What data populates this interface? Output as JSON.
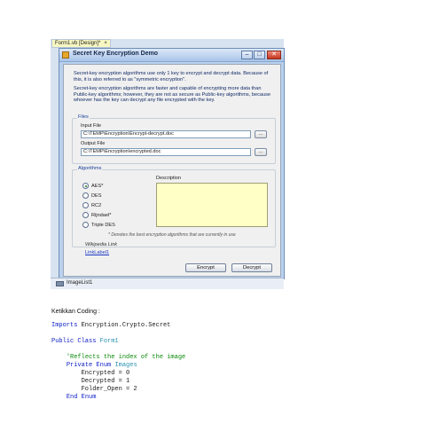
{
  "ide": {
    "doc_tab_label": "Form1.vb [Design]*",
    "doc_tab_close": "×",
    "tray_item": "ImageList1"
  },
  "form": {
    "title": "Secret Key Encryption Demo",
    "controls": {
      "minimize": "–",
      "maximize": "□",
      "close": "✕"
    },
    "description": [
      "Secret-key encryption algorithms use only 1 key to encrypt and decrypt data. Because of this, it is also referred to as \"symmetric encryption\".",
      "Secret-key encryption algorithms are faster and capable of encrypting more data than Public-key algorithms; however, they are not as secure as Public-key algorithms, because whoever has the key can decrypt any file encrypted with the key."
    ],
    "files": {
      "group_title": "Files",
      "input_label": "Input File",
      "input_value": "C:\\TEMP\\Encryption\\Encrypt-decrypt.doc",
      "output_label": "Output File",
      "output_value": "C:\\TEMP\\Encryption\\encrypted.doc",
      "browse_label": "..."
    },
    "algorithms": {
      "group_title": "Algorithms",
      "description_label": "Description",
      "options": [
        "AES*",
        "DES",
        "RC2",
        "Rijndael*",
        "Triple DES"
      ],
      "selected": "AES*",
      "note": "* Denotes the best encryption algorithms that are currently in use",
      "wikipedia_label": "Wikipedia Link",
      "link_label": "LinkLabel1"
    },
    "buttons": {
      "encrypt": "Encrypt",
      "decrypt": "Decrypt"
    }
  },
  "document": {
    "instruction": "Ketikkan Coding :",
    "code": {
      "imports_kw": "Imports",
      "imports_ns": "Encryption.Crypto.Secret",
      "class_kw": "Public Class",
      "class_name": "Form1",
      "comment": "'Reflects the index of the image",
      "enum_kw": "Private Enum",
      "enum_name": "Images",
      "members": [
        "Encrypted = 0",
        "Decrypted = 1",
        "Folder_Open = 2"
      ],
      "end_enum": "End Enum"
    }
  },
  "colors": {
    "designer_bg": "#d8e3f1",
    "form_bg": "#f0f0f0",
    "description_text": "#102a66",
    "keyword": "#1020c8",
    "type": "#2b91af",
    "comment": "#0b8a0b"
  }
}
